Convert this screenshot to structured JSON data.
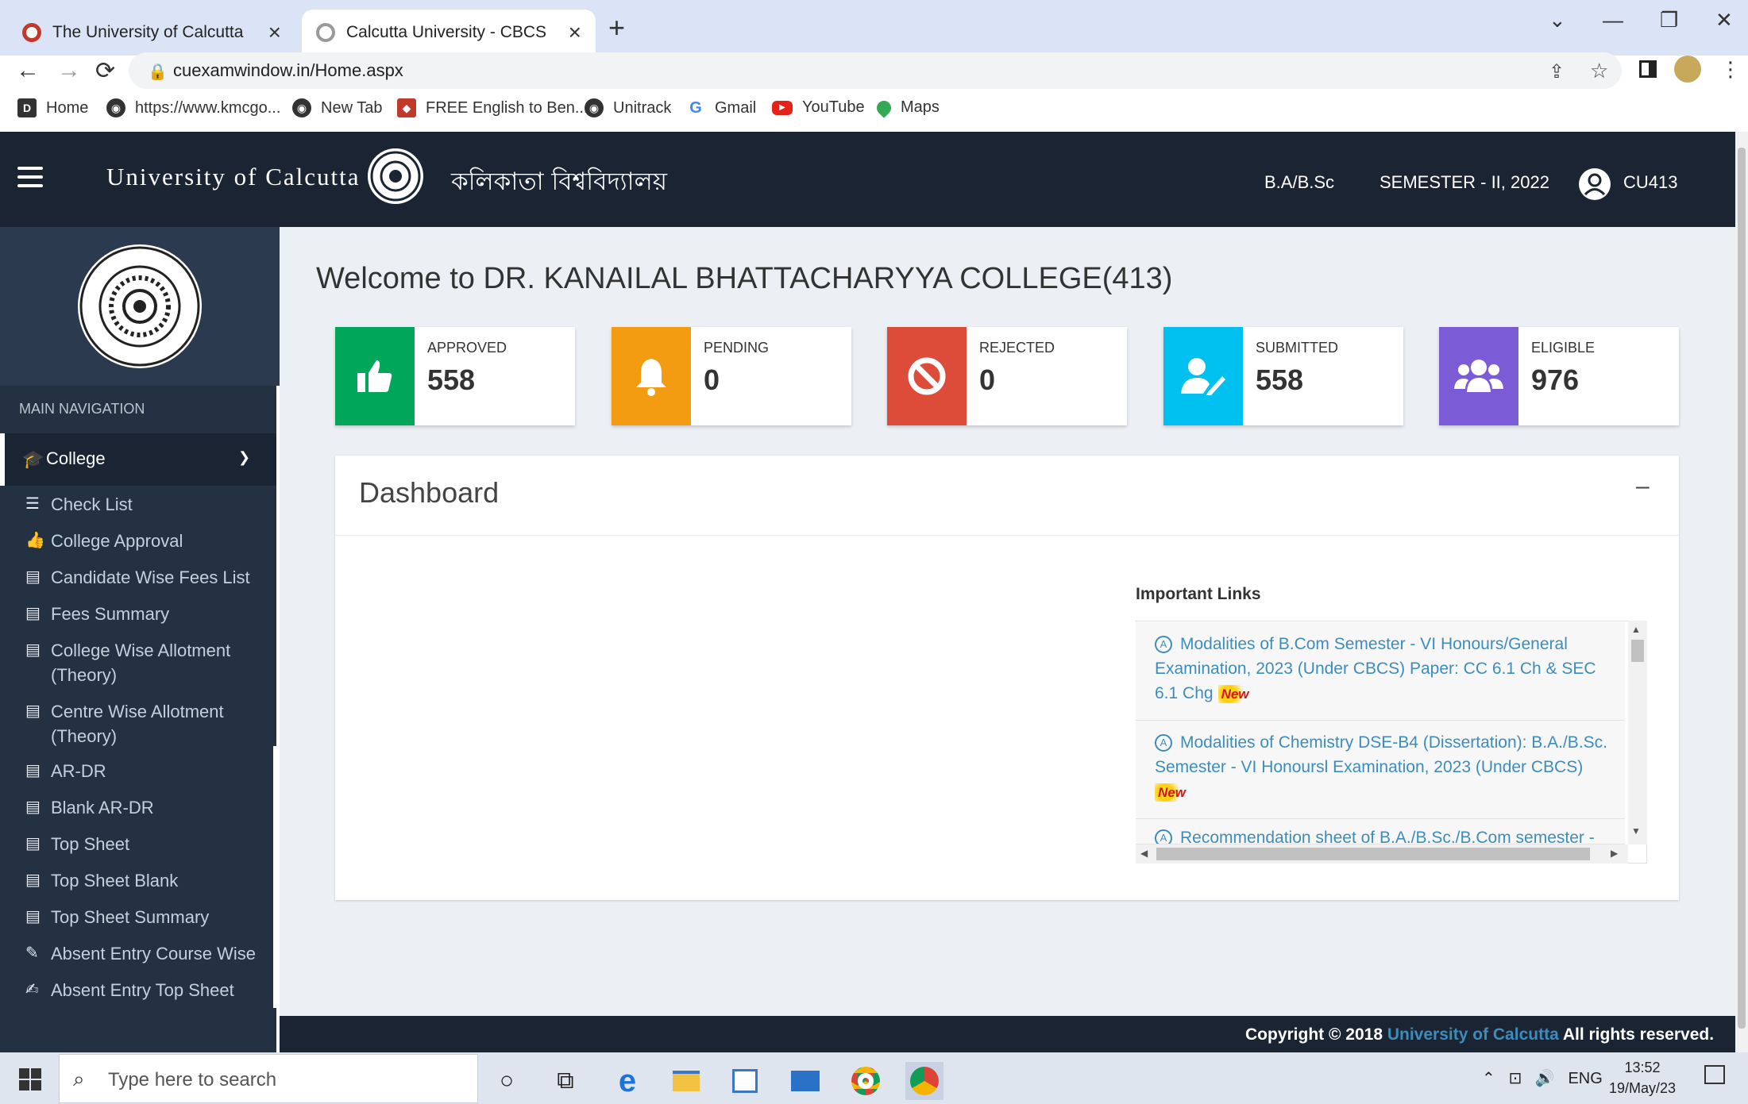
{
  "browser": {
    "tabs": [
      {
        "title": "The University of Calcutta",
        "active": false
      },
      {
        "title": "Calcutta University - CBCS",
        "active": true
      }
    ],
    "new_tab_symbol": "+",
    "window_controls": {
      "dropdown": "⌄",
      "minimize": "—",
      "restore": "❐",
      "close": "✕"
    },
    "url": "cuexamwindow.in/Home.aspx",
    "bookmarks": [
      {
        "label": "Home",
        "icon": "home-bookmark-icon"
      },
      {
        "label": "https://www.kmcgo...",
        "icon": "globe-icon"
      },
      {
        "label": "New Tab",
        "icon": "globe-icon"
      },
      {
        "label": "FREE English to Ben...",
        "icon": "red-app-icon"
      },
      {
        "label": "Unitrack",
        "icon": "globe-icon"
      },
      {
        "label": "Gmail",
        "icon": "google-icon"
      },
      {
        "label": "YouTube",
        "icon": "youtube-icon"
      },
      {
        "label": "Maps",
        "icon": "maps-icon"
      }
    ]
  },
  "header": {
    "brand_en": "University of Calcutta",
    "brand_bn": "কলিকাতা বিশ্ববিদ্যালয়",
    "course": "B.A/B.Sc",
    "semester": "SEMESTER - II, 2022",
    "user": "CU413"
  },
  "sidebar": {
    "section_title": "MAIN NAVIGATION",
    "active_group": "College",
    "items": [
      {
        "label": "Check List",
        "icon": "list-icon"
      },
      {
        "label": "College Approval",
        "icon": "thumbs-up-icon"
      },
      {
        "label": "Candidate Wise Fees List",
        "icon": "document-icon"
      },
      {
        "label": "Fees Summary",
        "icon": "document-icon"
      },
      {
        "label": "College Wise Allotment (Theory)",
        "icon": "document-icon"
      },
      {
        "label": "Centre Wise Allotment (Theory)",
        "icon": "document-icon"
      },
      {
        "label": "AR-DR",
        "icon": "document-icon"
      },
      {
        "label": "Blank AR-DR",
        "icon": "document-icon"
      },
      {
        "label": "Top Sheet",
        "icon": "document-icon"
      },
      {
        "label": "Top Sheet Blank",
        "icon": "document-icon"
      },
      {
        "label": "Top Sheet Summary",
        "icon": "document-icon"
      },
      {
        "label": "Absent Entry Course Wise",
        "icon": "pencil-icon"
      },
      {
        "label": "Absent Entry Top Sheet",
        "icon": "edit-icon"
      }
    ]
  },
  "main": {
    "welcome": "Welcome to DR. KANAILAL BHATTACHARYYA COLLEGE(413)",
    "cards": [
      {
        "label": "APPROVED",
        "value": "558",
        "color": "#00a65a",
        "icon": "thumbs-up-icon"
      },
      {
        "label": "PENDING",
        "value": "0",
        "color": "#f39c12",
        "icon": "bell-icon"
      },
      {
        "label": "REJECTED",
        "value": "0",
        "color": "#dd4b39",
        "icon": "ban-icon"
      },
      {
        "label": "SUBMITTED",
        "value": "558",
        "color": "#00c0ef",
        "icon": "user-edit-icon"
      },
      {
        "label": "ELIGIBLE",
        "value": "976",
        "color": "#7b5cd6",
        "icon": "users-icon"
      }
    ],
    "dashboard": {
      "title": "Dashboard",
      "collapse_symbol": "–",
      "important_links_title": "Important Links",
      "links": [
        {
          "text": "Modalities of B.Com Semester - VI Honours/General Examination, 2023 (Under CBCS) Paper: CC 6.1 Ch & SEC 6.1 Chg",
          "new": true
        },
        {
          "text": "Modalities of Chemistry DSE-B4 (Dissertation): B.A./B.Sc. Semester - VI Honoursl Examination, 2023 (Under CBCS)",
          "new": true
        },
        {
          "text": "Recommendation sheet of B.A./B.Sc./B.Com semester -",
          "new": false
        }
      ],
      "new_badge": "New"
    }
  },
  "footer": {
    "prefix": "Copyright © 2018",
    "org": "University of Calcutta",
    "suffix": "All rights reserved."
  },
  "taskbar": {
    "search_placeholder": "Type here to search",
    "lang": "ENG",
    "time": "13:52",
    "date": "19/May/23"
  },
  "colors": {
    "header_bg": "#1b2433",
    "sidebar_bg": "#243143",
    "content_bg": "#ecf0f5",
    "link": "#3c8dbc"
  }
}
